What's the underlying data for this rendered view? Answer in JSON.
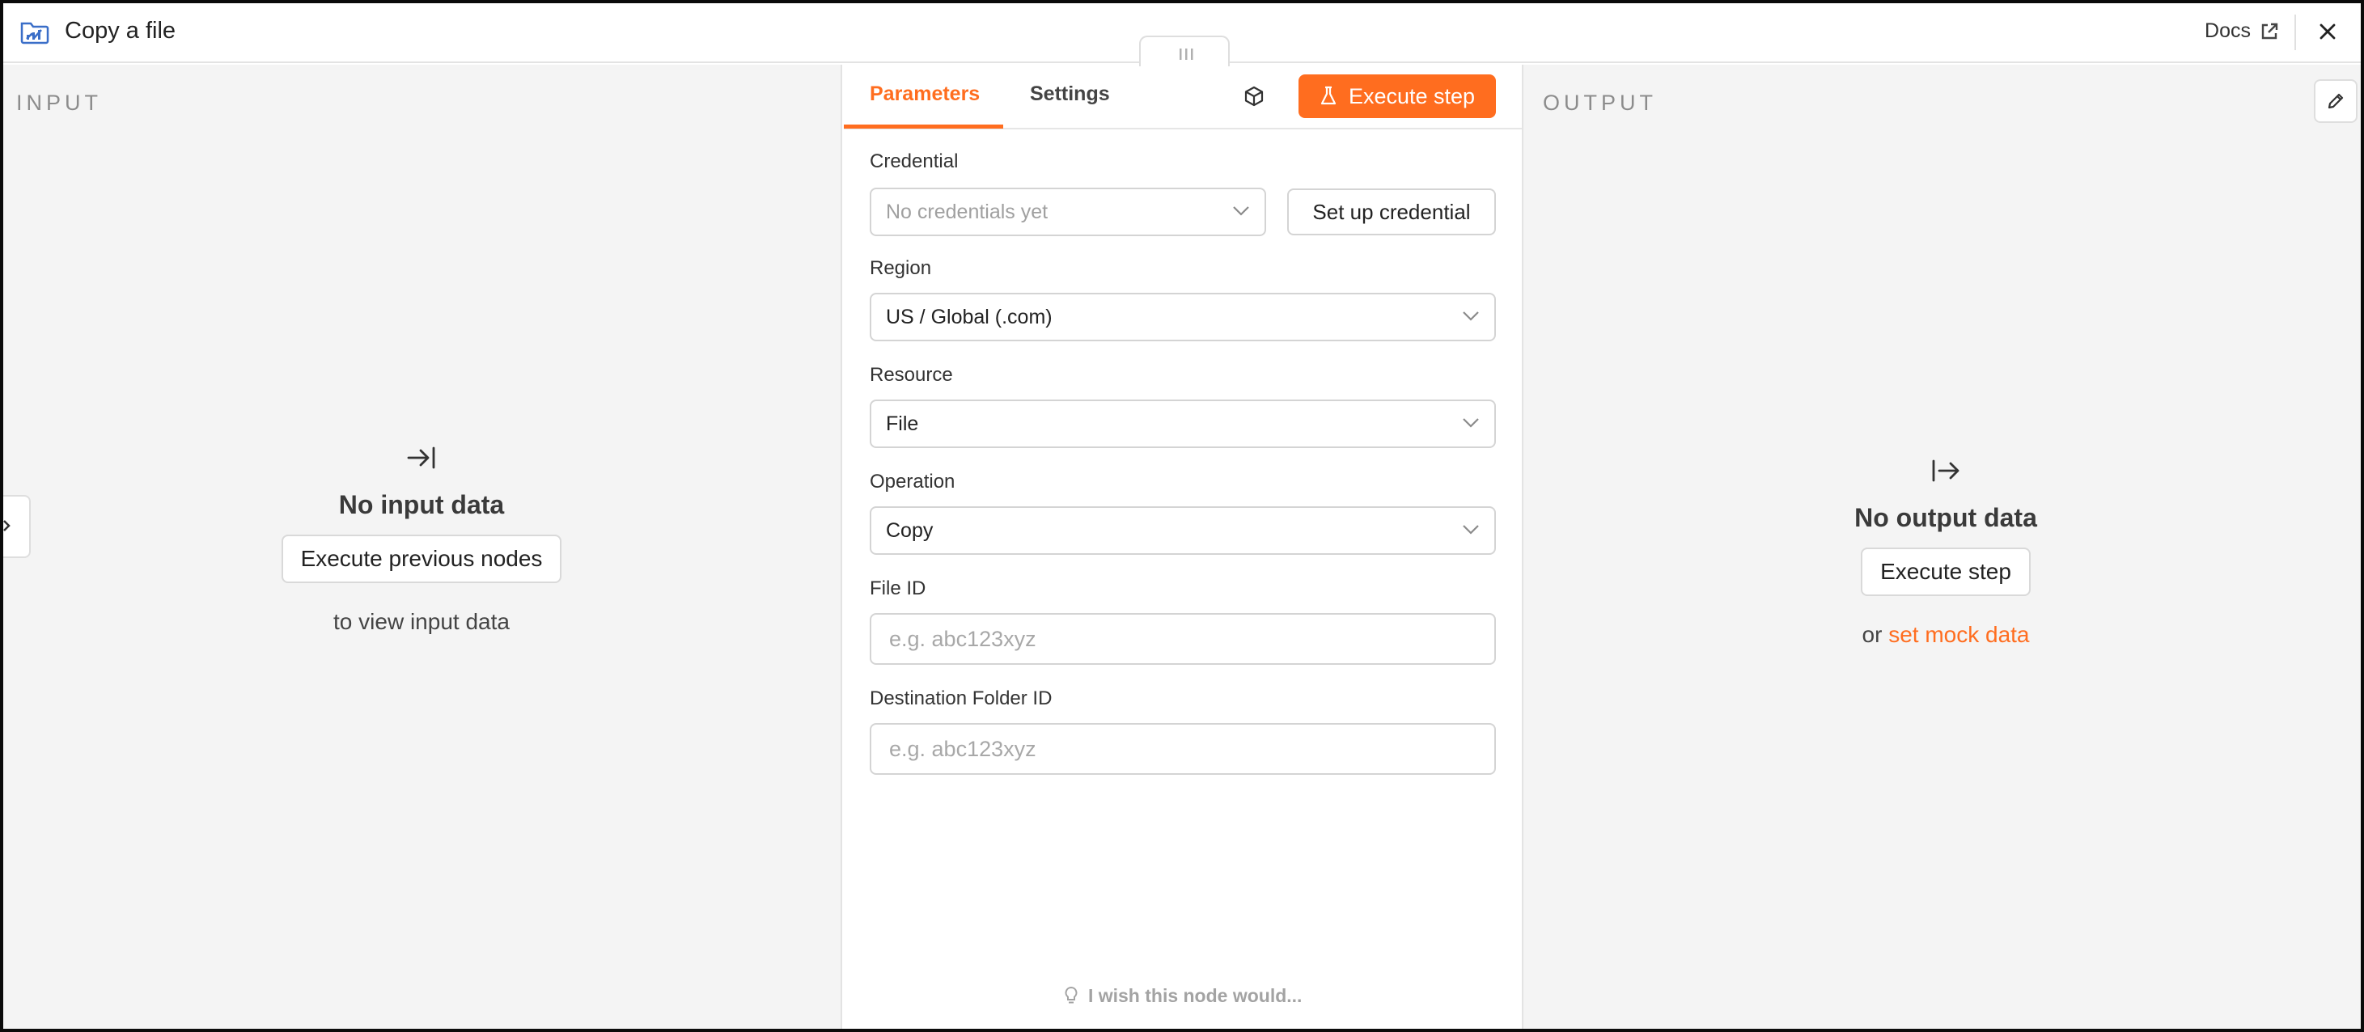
{
  "header": {
    "title": "Copy a file",
    "docs_label": "Docs",
    "icons": {
      "node": "chart-folder-icon",
      "docs": "external-link-icon",
      "close": "close-icon"
    }
  },
  "input_panel": {
    "label": "INPUT",
    "empty_title": "No input data",
    "button_label": "Execute previous nodes",
    "sub_text": "to view input data",
    "icon": "arrow-to-right-icon"
  },
  "params_panel": {
    "tabs": [
      {
        "label": "Parameters",
        "active": true
      },
      {
        "label": "Settings",
        "active": false
      }
    ],
    "execute_label": "Execute step",
    "fields": {
      "credential": {
        "label": "Credential",
        "placeholder": "No credentials yet",
        "button_label": "Set up credential"
      },
      "region": {
        "label": "Region",
        "value": "US / Global (.com)"
      },
      "resource": {
        "label": "Resource",
        "value": "File"
      },
      "operation": {
        "label": "Operation",
        "value": "Copy"
      },
      "file_id": {
        "label": "File ID",
        "placeholder": "e.g. abc123xyz"
      },
      "destination_folder_id": {
        "label": "Destination Folder ID",
        "placeholder": "e.g. abc123xyz"
      }
    },
    "wish_text": "I wish this node would..."
  },
  "output_panel": {
    "label": "OUTPUT",
    "empty_title": "No output data",
    "button_label": "Execute step",
    "or_text": "or",
    "mock_link": "set mock data",
    "icon": "arrow-from-bar-right-icon"
  },
  "colors": {
    "accent": "#ff6d1f",
    "panel_bg": "#f4f4f4",
    "node_icon": "#3a6ec8"
  }
}
